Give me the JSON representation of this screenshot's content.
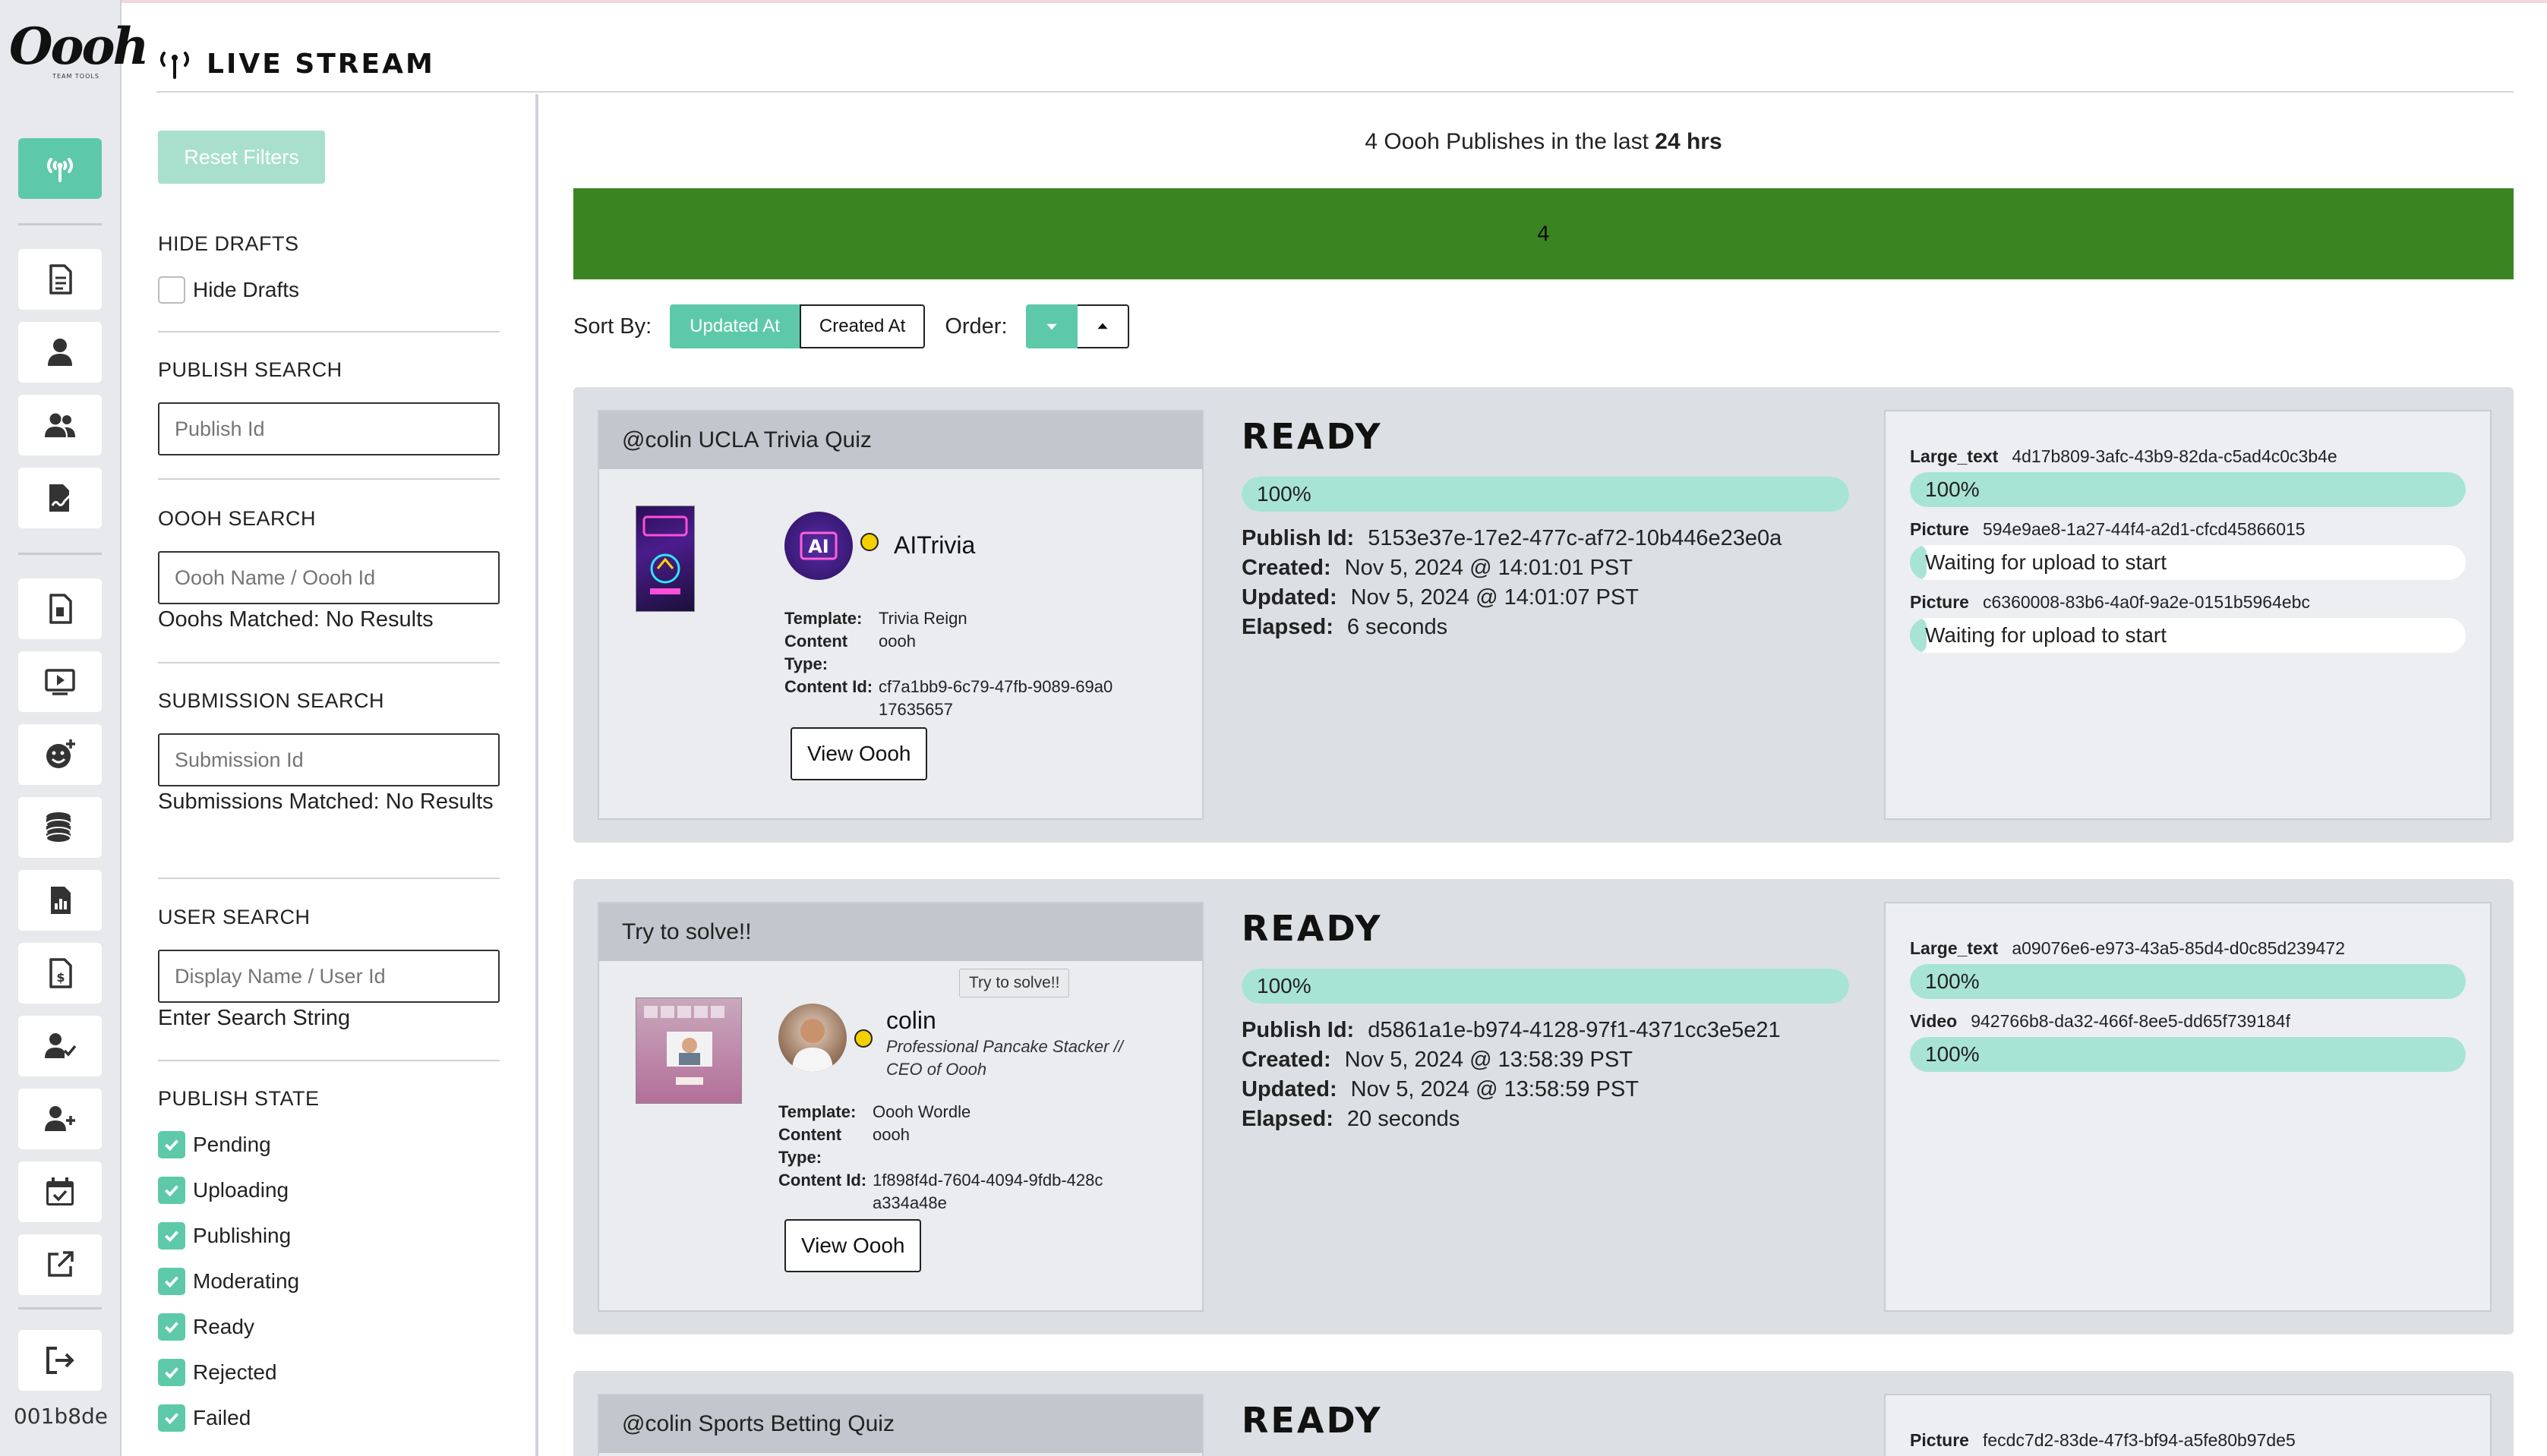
{
  "sidebar": {
    "logo": "Oooh",
    "logo_sub": "TEAM TOOLS",
    "user_id": "001b8de",
    "items": [
      {
        "name": "live-stream",
        "icon": "antenna-icon",
        "active": true
      },
      {
        "name": "documents",
        "icon": "document-icon"
      },
      {
        "name": "user",
        "icon": "user-icon"
      },
      {
        "name": "users",
        "icon": "users-icon"
      },
      {
        "name": "signature",
        "icon": "signature-icon"
      },
      {
        "name": "file",
        "icon": "file-icon"
      },
      {
        "name": "video",
        "icon": "video-icon"
      },
      {
        "name": "emoji-add",
        "icon": "emoji-add-icon"
      },
      {
        "name": "coins",
        "icon": "coins-icon"
      },
      {
        "name": "file-chart",
        "icon": "file-chart-icon"
      },
      {
        "name": "file-dollar",
        "icon": "file-dollar-icon"
      },
      {
        "name": "user-check",
        "icon": "user-check-icon"
      },
      {
        "name": "user-plus",
        "icon": "user-plus-icon"
      },
      {
        "name": "calendar",
        "icon": "calendar-check-icon"
      },
      {
        "name": "external",
        "icon": "external-link-icon"
      },
      {
        "name": "logout",
        "icon": "sign-out-icon"
      }
    ]
  },
  "header": {
    "title": "LIVE STREAM",
    "icon": "antenna-icon"
  },
  "filters": {
    "reset_label": "Reset Filters",
    "hide_drafts": {
      "heading": "HIDE DRAFTS",
      "label": "Hide Drafts",
      "checked": false
    },
    "publish_search": {
      "heading": "PUBLISH SEARCH",
      "placeholder": "Publish Id"
    },
    "oooh_search": {
      "heading": "OOOH SEARCH",
      "placeholder": "Oooh Name / Oooh Id",
      "note": "Ooohs Matched: No Results"
    },
    "submission_search": {
      "heading": "SUBMISSION SEARCH",
      "placeholder": "Submission Id",
      "note": "Submissions Matched: No Results"
    },
    "user_search": {
      "heading": "USER SEARCH",
      "placeholder": "Display Name / User Id",
      "note": "Enter Search String"
    },
    "publish_state": {
      "heading": "PUBLISH STATE",
      "options": [
        {
          "label": "Pending",
          "checked": true
        },
        {
          "label": "Uploading",
          "checked": true
        },
        {
          "label": "Publishing",
          "checked": true
        },
        {
          "label": "Moderating",
          "checked": true
        },
        {
          "label": "Ready",
          "checked": true
        },
        {
          "label": "Rejected",
          "checked": true
        },
        {
          "label": "Failed",
          "checked": true
        }
      ]
    }
  },
  "summary": {
    "count_text": "4 Oooh Publishes in the last",
    "window": "24 hrs",
    "bar_value": "4"
  },
  "sort": {
    "label": "Sort By:",
    "options": [
      {
        "label": "Updated At",
        "active": true
      },
      {
        "label": "Created At",
        "active": false
      }
    ],
    "order_label": "Order:",
    "order": "descending"
  },
  "publishes": [
    {
      "title": "@colin UCLA Trivia Quiz",
      "thumbnail": "trivia-thumbnail",
      "user_name": "AITrivia",
      "user_bio": "",
      "template": "Trivia Reign",
      "content_type": "oooh",
      "content_id": "cf7a1bb9-6c79-47fb-9089-69a017635657",
      "view_label": "View Oooh",
      "status": "READY",
      "progress_label": "100%",
      "progress": 1.0,
      "publish_id": "5153e37e-17e2-477c-af72-10b446e23e0a",
      "created": "Nov 5, 2024 @ 14:01:01 PST",
      "updated": "Nov 5, 2024 @ 14:01:07 PST",
      "elapsed": "6 seconds",
      "assets": [
        {
          "type": "Large_text",
          "id": "4d17b809-3afc-43b9-82da-c5ad4c0c3b4e",
          "status": "100%",
          "progress": 1.0
        },
        {
          "type": "Picture",
          "id": "594e9ae8-1a27-44f4-a2d1-cfcd45866015",
          "status": "Waiting for upload to start",
          "progress": 0.0
        },
        {
          "type": "Picture",
          "id": "c6360008-83b6-4a0f-9a2e-0151b5964ebc",
          "status": "Waiting for upload to start",
          "progress": 0.0
        }
      ]
    },
    {
      "title": "Try to solve!!",
      "tooltip": "Try to solve!!",
      "thumbnail": "wordle-thumbnail",
      "user_name": "colin",
      "user_bio": "Professional Pancake Stacker // CEO of Oooh",
      "template": "Oooh Wordle",
      "content_type": "oooh",
      "content_id": "1f898f4d-7604-4094-9fdb-428ca334a48e",
      "view_label": "View Oooh",
      "status": "READY",
      "progress_label": "100%",
      "progress": 1.0,
      "publish_id": "d5861a1e-b974-4128-97f1-4371cc3e5e21",
      "created": "Nov 5, 2024 @ 13:58:39 PST",
      "updated": "Nov 5, 2024 @ 13:58:59 PST",
      "elapsed": "20 seconds",
      "assets": [
        {
          "type": "Large_text",
          "id": "a09076e6-e973-43a5-85d4-d0c85d239472",
          "status": "100%",
          "progress": 1.0
        },
        {
          "type": "Video",
          "id": "942766b8-da32-466f-8ee5-dd65f739184f",
          "status": "100%",
          "progress": 1.0
        }
      ]
    },
    {
      "title": "@colin Sports Betting Quiz",
      "status": "READY",
      "assets": [
        {
          "type": "Picture",
          "id": "fecdc7d2-83de-47f3-bf94-a5fe80b97de5"
        }
      ]
    }
  ],
  "meta_labels": {
    "template": "Template:",
    "content_type": "Content Type:",
    "content_id": "Content Id:",
    "publish_id": "Publish Id:",
    "created": "Created:",
    "updated": "Updated:",
    "elapsed": "Elapsed:"
  },
  "colors": {
    "accent": "#5ec9a8",
    "bar_green": "#3a8421",
    "progress": "#a8e4d3",
    "card_bg": "#dcdfe4"
  }
}
